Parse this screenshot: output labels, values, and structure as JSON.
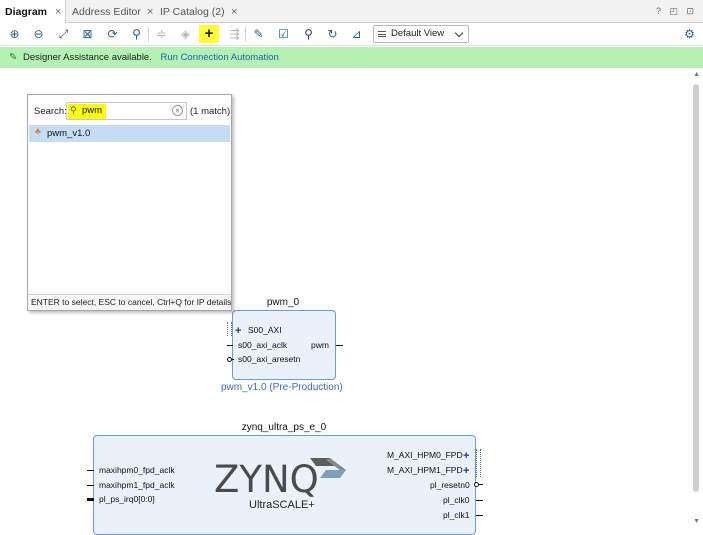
{
  "tabs": [
    {
      "label": "Diagram",
      "active": true
    },
    {
      "label": "Address Editor",
      "active": false
    },
    {
      "label": "IP Catalog (2)",
      "active": false
    }
  ],
  "window_icons": "? ◰ ⊡",
  "toolbar": {
    "icons": [
      "zoom-in-icon",
      "zoom-out-icon",
      "fit-icon",
      "zoom-fit-icon",
      "refresh-icon",
      "search-icon",
      "align-icon",
      "validate-icon",
      "add-ip-icon",
      "route-icon",
      "settings-icon",
      "check-icon",
      "pin-icon",
      "regenerate-icon",
      "optimize-icon"
    ],
    "view_select": "Default View"
  },
  "assist": {
    "message": "Designer Assistance available.",
    "link": "Run Connection Automation"
  },
  "search_popup": {
    "label": "Search:",
    "value": "pwm",
    "match_count": "(1 match)",
    "results": [
      "pwm_v1.0"
    ],
    "footer": "ENTER to select, ESC to cancel, Ctrl+Q for IP details"
  },
  "pwm_block": {
    "title": "pwm_0",
    "left_ports": [
      "S00_AXI",
      "s00_axi_aclk",
      "s00_axi_aresetn"
    ],
    "right_ports": [
      "pwm"
    ],
    "subtitle": "pwm_v1.0 (Pre-Production)"
  },
  "zynq_block": {
    "title": "zynq_ultra_ps_e_0",
    "left_ports": [
      "maxihpm0_fpd_aclk",
      "maxihpm1_fpd_aclk",
      "pl_ps_irq0[0:0]"
    ],
    "right_ports": [
      "M_AXI_HPM0_FPD",
      "M_AXI_HPM1_FPD",
      "pl_resetn0",
      "pl_clk0",
      "pl_clk1"
    ],
    "logo": "ZYNQ",
    "logo_sub": "UltraSCALE+"
  },
  "colors": {
    "assist_bg": "#b3f2b3",
    "highlight": "#ffff00",
    "block_fill": "#eaf1fa",
    "block_border": "#6d9bcc",
    "link": "#1b64b2"
  }
}
